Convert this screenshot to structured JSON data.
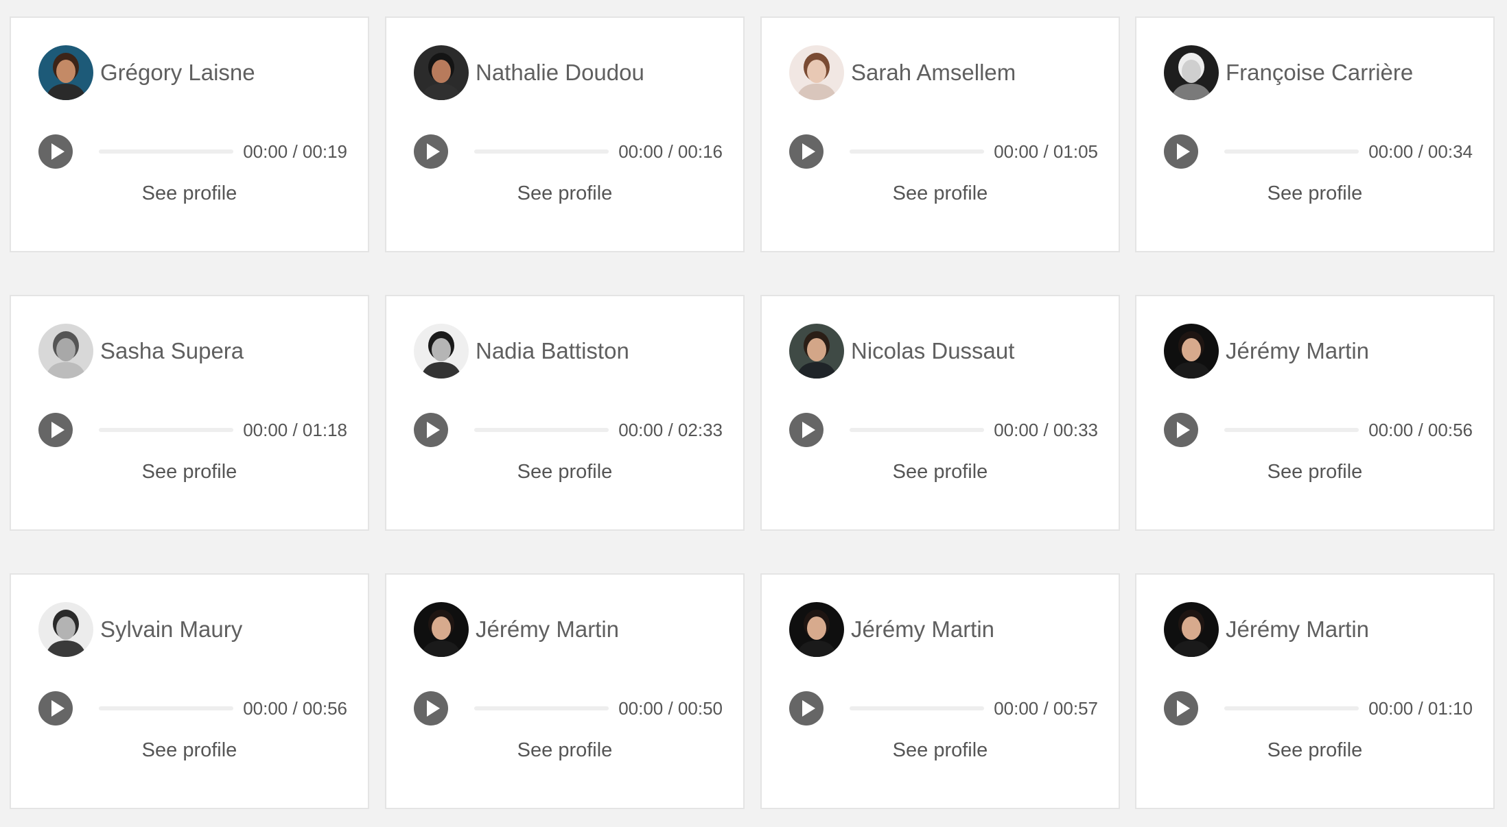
{
  "cards": [
    {
      "name": "Grégory Laisne",
      "current_time": "00:00",
      "duration": "00:19",
      "time_display": "00:00 / 00:19",
      "progress": 0,
      "profile_label": "See profile",
      "avatar": {
        "bg": "#1d5a78",
        "skin": "#c48a66",
        "hair": "#3c2418",
        "shirt": "#2a2a2a"
      }
    },
    {
      "name": "Nathalie Doudou",
      "current_time": "00:00",
      "duration": "00:16",
      "time_display": "00:00 / 00:16",
      "progress": 0,
      "profile_label": "See profile",
      "avatar": {
        "bg": "#2b2b2b",
        "skin": "#b87b5c",
        "hair": "#141414",
        "shirt": "#303030"
      }
    },
    {
      "name": "Sarah Amsellem",
      "current_time": "00:00",
      "duration": "01:05",
      "time_display": "00:00 / 01:05",
      "progress": 0,
      "profile_label": "See profile",
      "avatar": {
        "bg": "#f1e7e3",
        "skin": "#e8c8b4",
        "hair": "#7a4b33",
        "shirt": "#d9c6bc"
      }
    },
    {
      "name": "Françoise Carrière",
      "current_time": "00:00",
      "duration": "00:34",
      "time_display": "00:00 / 00:34",
      "progress": 0,
      "profile_label": "See profile",
      "avatar": {
        "bg": "#1e1e1e",
        "skin": "#cfcfcf",
        "hair": "#eeeeee",
        "shirt": "#7a7a7a"
      }
    },
    {
      "name": "Sasha Supera",
      "current_time": "00:00",
      "duration": "01:18",
      "time_display": "00:00 / 01:18",
      "progress": 0,
      "profile_label": "See profile",
      "avatar": {
        "bg": "#d8d8d8",
        "skin": "#a8a8a8",
        "hair": "#555555",
        "shirt": "#bcbcbc"
      }
    },
    {
      "name": "Nadia Battiston",
      "current_time": "00:00",
      "duration": "02:33",
      "time_display": "00:00 / 02:33",
      "progress": 0,
      "profile_label": "See profile",
      "avatar": {
        "bg": "#efefef",
        "skin": "#b5b5b5",
        "hair": "#1a1a1a",
        "shirt": "#333333"
      }
    },
    {
      "name": "Nicolas Dussaut",
      "current_time": "00:00",
      "duration": "00:33",
      "time_display": "00:00 / 00:33",
      "progress": 0,
      "profile_label": "See profile",
      "avatar": {
        "bg": "#3f4a45",
        "skin": "#d3a688",
        "hair": "#2a1e16",
        "shirt": "#1f2428"
      }
    },
    {
      "name": "Jérémy Martin",
      "current_time": "00:00",
      "duration": "00:56",
      "time_display": "00:00 / 00:56",
      "progress": 0,
      "profile_label": "See profile",
      "avatar": {
        "bg": "#0f0f0f",
        "skin": "#d7aa8d",
        "hair": "#1e1512",
        "shirt": "#1a1a1a"
      }
    },
    {
      "name": "Sylvain Maury",
      "current_time": "00:00",
      "duration": "00:56",
      "time_display": "00:00 / 00:56",
      "progress": 0,
      "profile_label": "See profile",
      "avatar": {
        "bg": "#ececec",
        "skin": "#b3b3b3",
        "hair": "#2a2a2a",
        "shirt": "#3a3a3a"
      }
    },
    {
      "name": "Jérémy Martin",
      "current_time": "00:00",
      "duration": "00:50",
      "time_display": "00:00 / 00:50",
      "progress": 0,
      "profile_label": "See profile",
      "avatar": {
        "bg": "#0f0f0f",
        "skin": "#d7aa8d",
        "hair": "#1e1512",
        "shirt": "#1a1a1a"
      }
    },
    {
      "name": "Jérémy Martin",
      "current_time": "00:00",
      "duration": "00:57",
      "time_display": "00:00 / 00:57",
      "progress": 0,
      "profile_label": "See profile",
      "avatar": {
        "bg": "#0f0f0f",
        "skin": "#d7aa8d",
        "hair": "#1e1512",
        "shirt": "#1a1a1a"
      }
    },
    {
      "name": "Jérémy Martin",
      "current_time": "00:00",
      "duration": "01:10",
      "time_display": "00:00 / 01:10",
      "progress": 0,
      "profile_label": "See profile",
      "avatar": {
        "bg": "#0f0f0f",
        "skin": "#d7aa8d",
        "hair": "#1e1512",
        "shirt": "#1a1a1a"
      }
    }
  ],
  "icons": {
    "play": "play-icon",
    "avatar": "avatar-photo"
  },
  "colors": {
    "page_background": "#f2f2f2",
    "card_background": "#ffffff",
    "card_border": "#e4e4e4",
    "text": "#5f5f5f",
    "play_button": "#666666",
    "track": "#eeeeee"
  }
}
